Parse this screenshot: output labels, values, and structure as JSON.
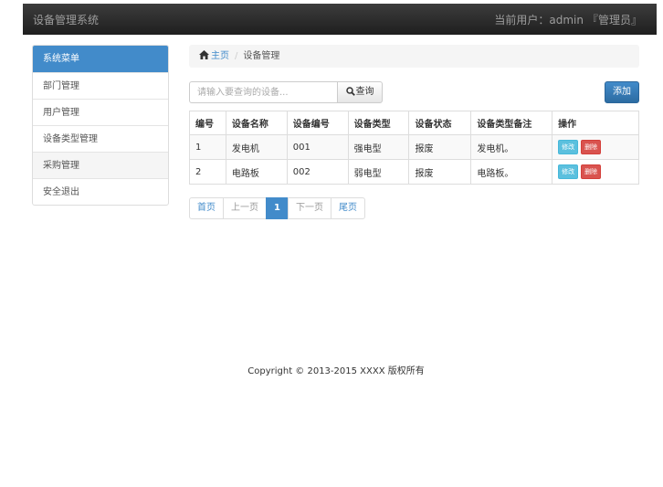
{
  "navbar": {
    "brand": "设备管理系统",
    "user_prefix": "当前用户：",
    "username": "admin",
    "role": "『管理员』"
  },
  "sidebar": {
    "header": "系统菜单",
    "items": [
      {
        "label": "部门管理"
      },
      {
        "label": "用户管理"
      },
      {
        "label": "设备类型管理"
      },
      {
        "label": "采购管理"
      },
      {
        "label": "安全退出"
      }
    ]
  },
  "breadcrumb": {
    "home": "主页",
    "separator": "/",
    "current": "设备管理"
  },
  "search": {
    "placeholder": "请输入要查询的设备...",
    "button_label": "查询"
  },
  "add_button": "添加",
  "table": {
    "headers": [
      "编号",
      "设备名称",
      "设备编号",
      "设备类型",
      "设备状态",
      "设备类型备注",
      "操作"
    ],
    "rows": [
      {
        "id": "1",
        "name": "发电机",
        "code": "001",
        "type": "强电型",
        "status": "报废",
        "remark": "发电机。",
        "edit": "修改",
        "delete": "删除"
      },
      {
        "id": "2",
        "name": "电路板",
        "code": "002",
        "type": "弱电型",
        "status": "报废",
        "remark": "电路板。",
        "edit": "修改",
        "delete": "删除"
      }
    ]
  },
  "pagination": {
    "first": "首页",
    "prev": "上一页",
    "current": "1",
    "next": "下一页",
    "last": "尾页"
  },
  "footer": "Copyright © 2013-2015 XXXX 版权所有",
  "colors": {
    "navbar": "#222222",
    "primary": "#428bca",
    "info": "#5bc0de",
    "danger": "#d9534f"
  }
}
